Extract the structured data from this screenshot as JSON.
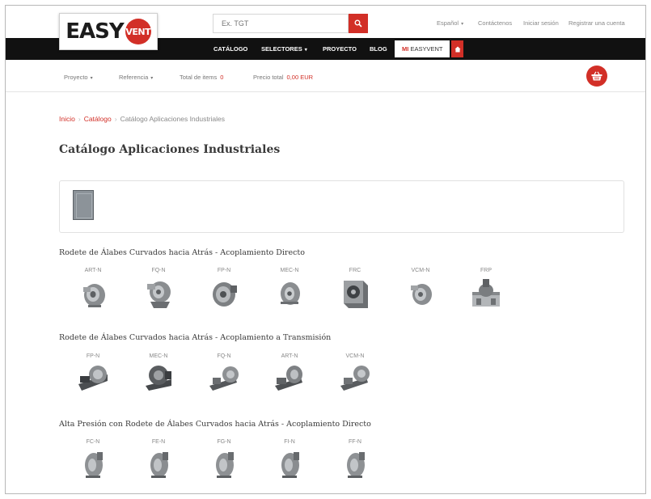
{
  "header": {
    "logo_text": "EASY",
    "logo_badge": "VENT",
    "search_placeholder": "Ex. TGT",
    "top_links": [
      "Español",
      "Contáctenos",
      "Iniciar sesión",
      "Registrar una cuenta"
    ]
  },
  "nav": {
    "items": [
      "CATÁLOGO",
      "SELECTORES",
      "PROYECTO",
      "BLOG"
    ],
    "mi_prefix": "MI",
    "mi_label": "EASYVENT"
  },
  "project_bar": {
    "proyecto": "Proyecto",
    "referencia": "Referencia",
    "total_items_label": "Total de items",
    "total_items_value": "0",
    "price_label": "Precio total",
    "price_value": "0,00 EUR"
  },
  "breadcrumb": [
    "Inicio",
    "Catálogo",
    "Catálogo Aplicaciones Industriales"
  ],
  "page_title": "Catálogo Aplicaciones Industriales",
  "sections": [
    {
      "title": "Rodete de Álabes Curvados hacia Atrás - Acoplamiento Directo",
      "products": [
        "ART-N",
        "FQ-N",
        "FP-N",
        "MEC-N",
        "FRC",
        "VCM-N",
        "FRP"
      ]
    },
    {
      "title": "Rodete de Álabes Curvados hacia Atrás - Acoplamiento a Transmisión",
      "products": [
        "FP-N",
        "MEC-N",
        "FQ-N",
        "ART-N",
        "VCM-N"
      ]
    },
    {
      "title": "Alta Presión con Rodete de Álabes Curvados hacia Atrás - Acoplamiento Directo",
      "products": [
        "FC-N",
        "FE-N",
        "FG-N",
        "FI-N",
        "FF-N"
      ]
    }
  ],
  "colors": {
    "brand_red": "#d22f27",
    "nav_black": "#111111"
  }
}
